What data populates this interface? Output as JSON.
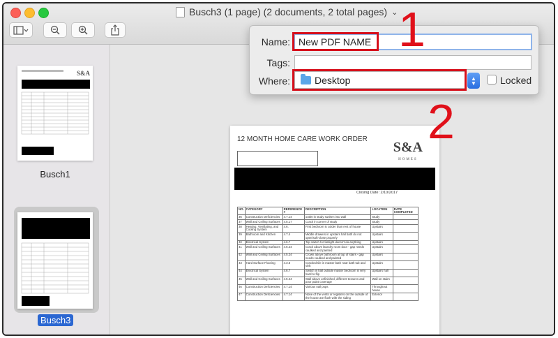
{
  "window": {
    "title": "Busch3 (1 page) (2 documents, 2 total pages)"
  },
  "toolbar": {
    "sidebar_toggle": "sidebar-icon",
    "zoom_out": "zoom-out-icon",
    "zoom_in": "zoom-in-icon",
    "share": "share-icon"
  },
  "sidebar": {
    "items": [
      {
        "label": "Busch1",
        "selected": false
      },
      {
        "label": "Busch3",
        "selected": true
      }
    ]
  },
  "dialog": {
    "name_label": "Name:",
    "name_value": "New PDF NAME",
    "tags_label": "Tags:",
    "tags_value": "",
    "where_label": "Where:",
    "where_value": "Desktop",
    "locked_label": "Locked",
    "locked_checked": false
  },
  "annotations": {
    "step1": "1",
    "step2": "2",
    "color": "#e0101a"
  },
  "document": {
    "title": "12 MONTH HOME CARE WORK ORDER",
    "logo": "S&A",
    "logo_sub": "HOMES",
    "closing_date": "Closing Date: 2/10/2017",
    "columns": [
      "NO.",
      "CATEGORY",
      "REFERENCE #",
      "DESCRIPTION",
      "LOCATION",
      "DATE COMPLETED"
    ],
    "rows": [
      [
        "36",
        "Construction Deficiencies",
        "4.7.14",
        "outlet in study sunken into wall",
        "Study",
        ""
      ],
      [
        "37",
        "Wall and Ceiling Surfaces",
        "4.5.17",
        "Crack in corner of study",
        "Study",
        ""
      ],
      [
        "38",
        "Heating, Ventilating, and Cooling System",
        "4.6.",
        "First bedroom is colder than rest of house",
        "Upstairs",
        ""
      ],
      [
        "39",
        "Bathroom and Kitchen",
        "4.7.4",
        "Middle drawers in upstairs hall bath do not open/soft-close properly",
        "Upstairs",
        ""
      ],
      [
        "40",
        "Electrical System",
        "4.6.7",
        "Top switch for fanlight doesn't do anything",
        "Upstairs",
        ""
      ],
      [
        "41",
        "Wall and Ceiling Surfaces",
        "4.5.24",
        "Crack above laundry room door - gap needs caulked and painted",
        "Upstairs",
        ""
      ],
      [
        "42",
        "Wall and Ceiling Surfaces",
        "4.5.24",
        "Crown above bathroom at top of stairs - gap needs caulked and painted",
        "Upstairs",
        ""
      ],
      [
        "43",
        "Hard Surface Flooring",
        "4.3.5",
        "Cracked tile in master bath near bath tub and sink",
        "Upstairs",
        ""
      ],
      [
        "44",
        "Electrical System",
        "4.6.7",
        "Switch in hall outside master bedroom is very hard to flip",
        "Upstairs hall",
        ""
      ],
      [
        "45",
        "Wall and Ceiling Surfaces",
        "4.5.24",
        "Wall above unfinished, different textures and poor paint coverage",
        "Wall on stairs",
        ""
      ],
      [
        "46",
        "Construction Deficiencies",
        "4.7.14",
        "Various nail pops",
        "Throughout house",
        ""
      ],
      [
        "47",
        "Construction Deficiencies",
        "4.7.14",
        "None of the vents or registers on the outside of the house are flush with the siding",
        "Exterior",
        ""
      ]
    ]
  }
}
